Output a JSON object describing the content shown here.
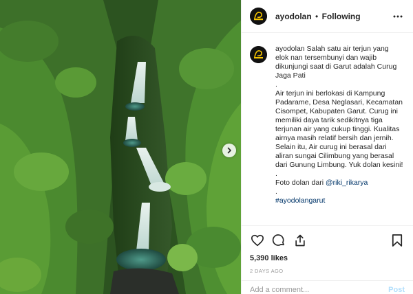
{
  "post": {
    "username": "ayodolan",
    "follow_state": "Following",
    "separator": "•",
    "avatar_text": "ayodolan"
  },
  "caption": {
    "username": "ayodolan",
    "intro": "Salah satu air terjun yang elok nan tersembunyi dan wajib dikunjungi saat di Garut adalah Curug Jaga Pati",
    "dot1": ".",
    "body": "Air terjun ini berlokasi di Kampung Padarame, Desa Neglasari, Kecamatan Cisompet, Kabupaten Garut. Curug ini memiliki daya tarik sedikitnya tiga terjunan air yang cukup tinggi. Kualitas airnya masih relatif bersih dan jernih. Selain itu, Air curug ini berasal dari aliran sungai Cilimbung yang berasal dari Gunung Limbung. Yuk dolan kesini!",
    "dot2": ".",
    "credit_prefix": "Foto dolan dari",
    "credit_handle": "@riki_rikarya",
    "dot3": ".",
    "hashtag": "#ayodolangarut"
  },
  "stats": {
    "likes": "5,390 likes",
    "time_ago": "2 DAYS AGO"
  },
  "comment_box": {
    "placeholder": "Add a comment...",
    "post_label": "Post"
  },
  "icons": {
    "more": "more-options-icon",
    "like": "heart-icon",
    "comment": "comment-icon",
    "share": "share-icon",
    "save": "bookmark-icon",
    "next": "chevron-right-icon"
  },
  "colors": {
    "link": "#003569",
    "post_button": "#b2dffc",
    "meta_text": "#999999",
    "avatar_bg": "#111111",
    "avatar_logo": "#f5c400"
  }
}
